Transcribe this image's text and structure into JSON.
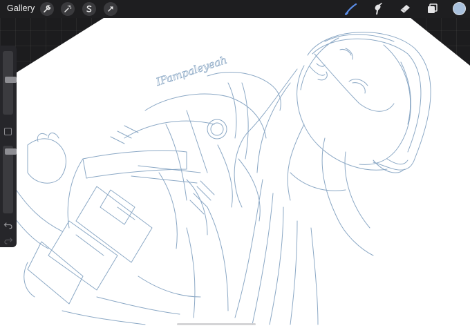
{
  "toolbar": {
    "gallery_label": "Gallery",
    "left_tools": [
      "wrench-icon",
      "magic-wand-icon",
      "selection-s-icon",
      "transform-arrow-icon"
    ],
    "right_tools": [
      "brush-icon",
      "smudge-icon",
      "eraser-icon",
      "layers-icon"
    ],
    "active_tool": "brush-icon",
    "active_color": "#a9c1dd"
  },
  "sidebar": {
    "brush_size": 0.55,
    "brush_opacity": 0.95,
    "controls": [
      "brush-size-slider",
      "modify-button",
      "opacity-slider",
      "undo-icon",
      "redo-icon"
    ]
  },
  "canvas": {
    "paper_color": "#ffffff",
    "sketch_color": "#7f9fbf",
    "signature_text": "IPampaleyeah"
  }
}
